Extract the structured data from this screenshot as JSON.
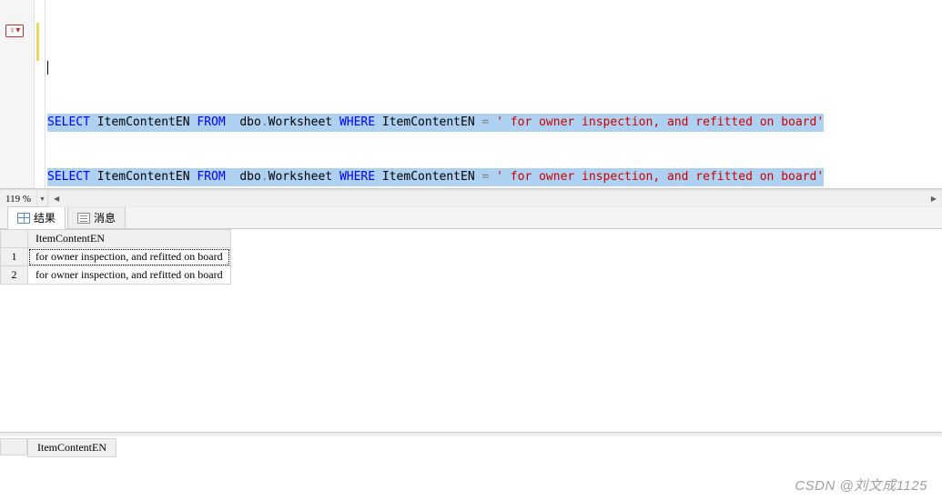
{
  "editor": {
    "marker_glyph": "♀▾",
    "lines": [
      {
        "highlighted": true,
        "tokens": [
          {
            "cls": "kw",
            "text": "SELECT"
          },
          {
            "cls": "txt",
            "text": " ItemContentEN "
          },
          {
            "cls": "kw",
            "text": "FROM"
          },
          {
            "cls": "txt",
            "text": "  dbo"
          },
          {
            "cls": "op",
            "text": "."
          },
          {
            "cls": "txt",
            "text": "Worksheet "
          },
          {
            "cls": "kw",
            "text": "WHERE"
          },
          {
            "cls": "txt",
            "text": " ItemContentEN "
          },
          {
            "cls": "op",
            "text": "="
          },
          {
            "cls": "str",
            "text": " ' for owner inspection, and refitted on board'"
          }
        ]
      },
      {
        "highlighted": true,
        "tokens": [
          {
            "cls": "kw",
            "text": "SELECT"
          },
          {
            "cls": "txt",
            "text": " ItemContentEN "
          },
          {
            "cls": "kw",
            "text": "FROM"
          },
          {
            "cls": "txt",
            "text": "  dbo"
          },
          {
            "cls": "op",
            "text": "."
          },
          {
            "cls": "txt",
            "text": "Worksheet "
          },
          {
            "cls": "kw",
            "text": "WHERE"
          },
          {
            "cls": "txt",
            "text": " ItemContentEN "
          },
          {
            "cls": "op",
            "text": "="
          },
          {
            "cls": "str",
            "text": " ' for owner inspection, and refitted on board'"
          }
        ]
      }
    ]
  },
  "zoom": {
    "level": "119 %"
  },
  "tabs": {
    "results_label": "结果",
    "messages_label": "消息"
  },
  "results": {
    "column_header": "ItemContentEN",
    "rows": [
      {
        "num": "1",
        "val": " for owner inspection, and refitted on board"
      },
      {
        "num": "2",
        "val": " for owner inspection, and refitted on board"
      }
    ]
  },
  "lower": {
    "column_header": "ItemContentEN"
  },
  "watermark": "CSDN @刘文成1125"
}
